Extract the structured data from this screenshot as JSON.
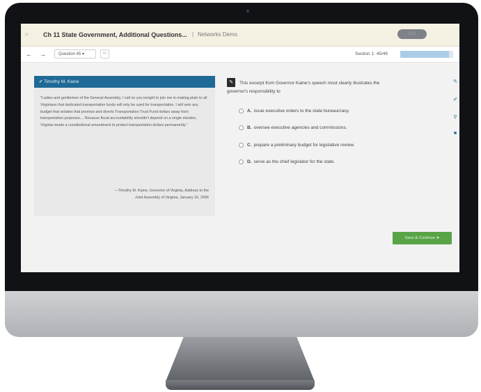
{
  "topbar": {
    "menu_glyph": "≡",
    "assignment_title": "Ch 11 State Government, Additional Questions...",
    "separator": "|",
    "course_name": "Networks Demo",
    "account_label": "Exit"
  },
  "toolbar": {
    "prev_label": "←",
    "next_label": "→",
    "question_select": "Question 45 ▾",
    "flag_label": "⚐",
    "section_label": "Section 1: 45/49",
    "section_progress": 0.92
  },
  "passage": {
    "author_tab": "✔ Timothy M. Kaine",
    "text": "\"Ladies and gentlemen of the General Assembly, I call on you tonight to join me in making plain to all Virginians that dedicated transportation funds will only be used for transportation. I will veto any budget that violates that promise and diverts Transportation Trust Fund dollars away from transportation purposes.... Because fiscal accountability shouldn't depend on a single election, Virginia needs a constitutional amendment to protect transportation dollars permanently.\"",
    "citation_line1": "—Timothy M. Kaine, Governor of Virginia, Address to the",
    "citation_line2": "Joint Assembly of Virginia, January 16, 2006"
  },
  "question": {
    "icon": "✎",
    "stem": "This excerpt from Governor Kaine's speech most clearly illustrates the governor's responsibility to",
    "choices": [
      {
        "letter": "A.",
        "text": "issue executive orders to the state bureaucracy."
      },
      {
        "letter": "B.",
        "text": "oversee executive agencies and commissions."
      },
      {
        "letter": "C.",
        "text": "prepare a preliminary budget for legislative review."
      },
      {
        "letter": "D.",
        "text": "serve as the chief legislator for the state."
      }
    ]
  },
  "tools": [
    "✎",
    "✐",
    "⚲",
    "■"
  ],
  "save_button": "Save & Continue ➤",
  "colors": {
    "header_blue": "#1f6a96",
    "save_green": "#58a447",
    "progress_blue": "#a9cde8"
  }
}
